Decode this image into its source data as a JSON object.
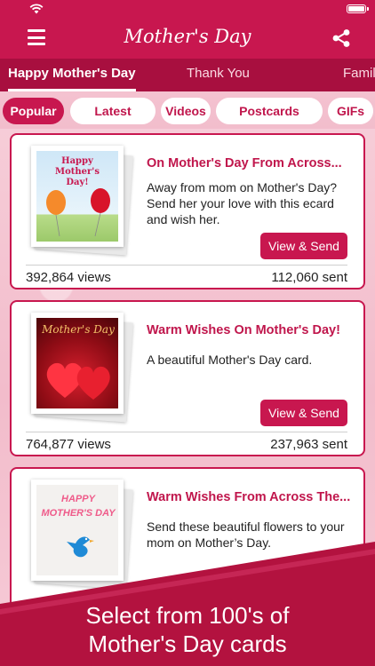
{
  "header": {
    "title": "Mother's Day"
  },
  "top_tabs": [
    {
      "label": "Happy Mother's Day",
      "active": true
    },
    {
      "label": "Thank You",
      "active": false
    },
    {
      "label": "Family",
      "active": false
    }
  ],
  "filters": [
    {
      "label": "Popular",
      "active": true
    },
    {
      "label": "Latest",
      "active": false
    },
    {
      "label": "Videos",
      "active": false
    },
    {
      "label": "Postcards",
      "active": false
    },
    {
      "label": "GIFs",
      "active": false
    }
  ],
  "cards": [
    {
      "title": "On Mother's Day From Across...",
      "description": "Away from mom on Mother's Day? Send her your love with this ecard and wish her.",
      "button": "View & Send",
      "views": "392,864 views",
      "sent": "112,060 sent",
      "thumb_text": "Happy Mother's Day!"
    },
    {
      "title": "Warm Wishes On Mother's Day!",
      "description": "A beautiful Mother's Day card.",
      "button": "View & Send",
      "views": "764,877 views",
      "sent": "237,963 sent",
      "thumb_text": "Mother's Day"
    },
    {
      "title": "Warm Wishes From Across The...",
      "description": "Send these beautiful flowers to your mom on Mother’s Day.",
      "thumb_text": "HAPPY MOTHER'S DAY"
    }
  ],
  "promo": {
    "line1": "Select from 100's of",
    "line2": "Mother's Day cards"
  },
  "colors": {
    "brand": "#c8174f",
    "tab_bar": "#a80f3f",
    "background": "#f6cdd8"
  }
}
